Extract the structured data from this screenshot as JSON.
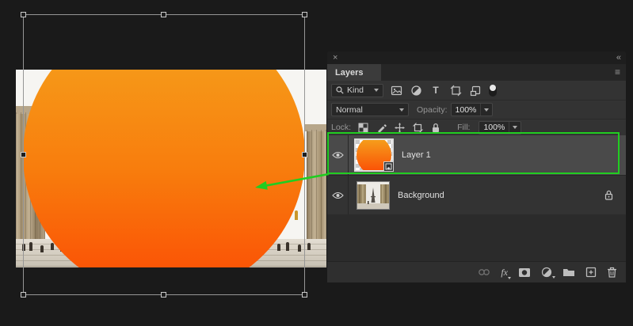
{
  "app": "Photoshop",
  "glyphs": {
    "close": "×",
    "collapse": "«",
    "panel_menu": "≡",
    "type_filter": "T",
    "fx": "fx"
  },
  "layers_panel": {
    "tab_label": "Layers",
    "filter_bar": {
      "kind_value": "Kind",
      "filter_type_icons": [
        "pixel-layer",
        "adjustment-layer",
        "type-layer",
        "shape-layer",
        "smart-object"
      ],
      "filter_toggle": "on"
    },
    "blend_bar": {
      "blend_mode": "Normal",
      "opacity_label": "Opacity:",
      "opacity_value": "100%"
    },
    "lock_bar": {
      "lock_label": "Lock:",
      "lock_icons": [
        "lock-transparent-pixels",
        "lock-image-pixels",
        "lock-position",
        "lock-artboard",
        "lock-all"
      ],
      "fill_label": "Fill:",
      "fill_value": "100%"
    },
    "layers": [
      {
        "name": "Layer 1",
        "selected": true,
        "visible": true,
        "kind": "smart-object",
        "locked": false
      },
      {
        "name": "Background",
        "selected": false,
        "visible": true,
        "kind": "image",
        "locked": true
      }
    ],
    "footer_tools": [
      "link-layers",
      "layer-styles",
      "add-layer-mask",
      "new-adjustment-layer",
      "new-group",
      "new-layer",
      "delete-layer"
    ]
  },
  "canvas": {
    "content": "photo of columned plaza with Eiffel Tower, covered by orange gradient circle smart object",
    "transform_handle_count": 8,
    "circle_gradient_top": "#f5a61e",
    "circle_gradient_bottom": "#fb4a04"
  },
  "annotation": {
    "highlight_target": "Layer 1 row",
    "color": "#21cd21"
  }
}
